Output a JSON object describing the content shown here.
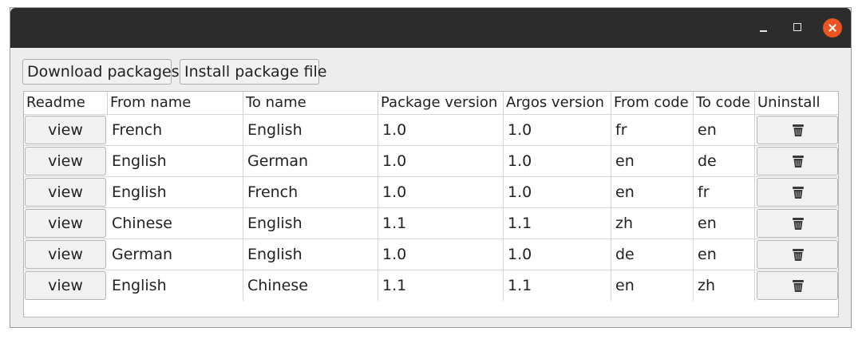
{
  "window": {
    "controls": {
      "minimize_icon": "minimize-icon",
      "maximize_icon": "maximize-icon",
      "close_icon": "close-icon",
      "close_color": "#e95420"
    }
  },
  "toolbar": {
    "download_label": "Download packages",
    "install_label": "Install package file"
  },
  "table": {
    "headers": [
      "Readme",
      "From name",
      "To name",
      "Package version",
      "Argos version",
      "From code",
      "To code",
      "Uninstall"
    ],
    "rows": [
      {
        "readme": "view",
        "from_name": "French",
        "to_name": "English",
        "package_version": "1.0",
        "argos_version": "1.0",
        "from_code": "fr",
        "to_code": "en",
        "uninstall_icon": "trash-icon"
      },
      {
        "readme": "view",
        "from_name": "English",
        "to_name": "German",
        "package_version": "1.0",
        "argos_version": "1.0",
        "from_code": "en",
        "to_code": "de",
        "uninstall_icon": "trash-icon"
      },
      {
        "readme": "view",
        "from_name": "English",
        "to_name": "French",
        "package_version": "1.0",
        "argos_version": "1.0",
        "from_code": "en",
        "to_code": "fr",
        "uninstall_icon": "trash-icon"
      },
      {
        "readme": "view",
        "from_name": "Chinese",
        "to_name": "English",
        "package_version": "1.1",
        "argos_version": "1.1",
        "from_code": "zh",
        "to_code": "en",
        "uninstall_icon": "trash-icon"
      },
      {
        "readme": "view",
        "from_name": "German",
        "to_name": "English",
        "package_version": "1.0",
        "argos_version": "1.0",
        "from_code": "de",
        "to_code": "en",
        "uninstall_icon": "trash-icon"
      },
      {
        "readme": "view",
        "from_name": "English",
        "to_name": "Chinese",
        "package_version": "1.1",
        "argos_version": "1.1",
        "from_code": "en",
        "to_code": "zh",
        "uninstall_icon": "trash-icon"
      }
    ]
  }
}
